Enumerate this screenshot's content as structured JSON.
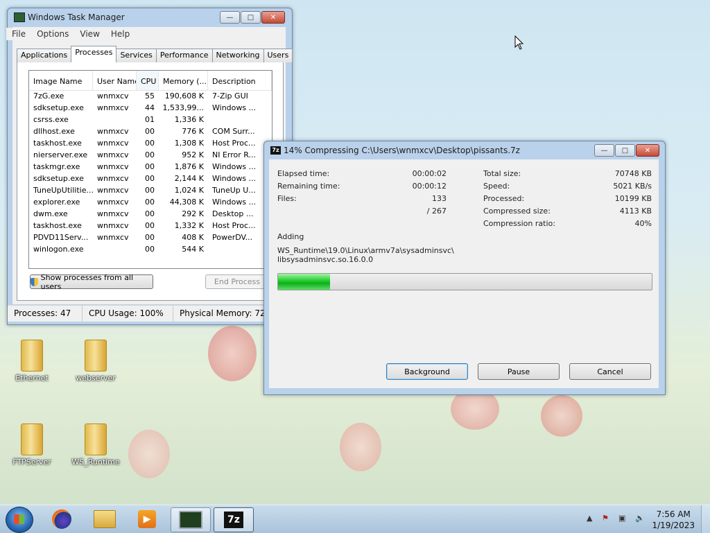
{
  "taskmgr": {
    "title": "Windows Task Manager",
    "menu": [
      "File",
      "Options",
      "View",
      "Help"
    ],
    "tabs": [
      "Applications",
      "Processes",
      "Services",
      "Performance",
      "Networking",
      "Users"
    ],
    "active_tab": "Processes",
    "columns": [
      "Image Name",
      "User Name",
      "CPU",
      "Memory (...",
      "Description"
    ],
    "rows": [
      [
        "7zG.exe",
        "wnmxcv",
        "55",
        "190,608 K",
        "7-Zip GUI"
      ],
      [
        "sdksetup.exe",
        "wnmxcv",
        "44",
        "1,533,99...",
        "Windows ..."
      ],
      [
        "csrss.exe",
        "",
        "01",
        "1,336 K",
        ""
      ],
      [
        "dllhost.exe",
        "wnmxcv",
        "00",
        "776 K",
        "COM Surr..."
      ],
      [
        "taskhost.exe",
        "wnmxcv",
        "00",
        "1,308 K",
        "Host Proc..."
      ],
      [
        "nierserver.exe",
        "wnmxcv",
        "00",
        "952 K",
        "NI Error R..."
      ],
      [
        "taskmgr.exe",
        "wnmxcv",
        "00",
        "1,876 K",
        "Windows ..."
      ],
      [
        "sdksetup.exe",
        "wnmxcv",
        "00",
        "2,144 K",
        "Windows ..."
      ],
      [
        "TuneUpUtilitie...",
        "wnmxcv",
        "00",
        "1,024 K",
        "TuneUp U..."
      ],
      [
        "explorer.exe",
        "wnmxcv",
        "00",
        "44,308 K",
        "Windows ..."
      ],
      [
        "dwm.exe",
        "wnmxcv",
        "00",
        "292 K",
        "Desktop ..."
      ],
      [
        "taskhost.exe",
        "wnmxcv",
        "00",
        "1,332 K",
        "Host Proc..."
      ],
      [
        "PDVD11Serv...",
        "wnmxcv",
        "00",
        "408 K",
        "PowerDV..."
      ],
      [
        "winlogon.exe",
        "",
        "00",
        "544 K",
        ""
      ]
    ],
    "show_all_label": "Show processes from all users",
    "end_process_label": "End Process",
    "status": {
      "processes": "Processes: 47",
      "cpu": "CPU Usage: 100%",
      "memory": "Physical Memory: 72%"
    }
  },
  "sevenzip": {
    "title": "14% Compressing C:\\Users\\wnmxcv\\Desktop\\pissants.7z",
    "elapsed_label": "Elapsed time:",
    "elapsed_value": "00:00:02",
    "remaining_label": "Remaining time:",
    "remaining_value": "00:00:12",
    "files_label": "Files:",
    "files_value": "133",
    "files_total": "/ 267",
    "total_size_label": "Total size:",
    "total_size_value": "70748 KB",
    "speed_label": "Speed:",
    "speed_value": "5021 KB/s",
    "processed_label": "Processed:",
    "processed_value": "10199 KB",
    "compressed_label": "Compressed size:",
    "compressed_value": "4113 KB",
    "ratio_label": "Compression ratio:",
    "ratio_value": "40%",
    "adding_label": "Adding",
    "current_path_line1": "WS_Runtime\\19.0\\Linux\\armv7a\\sysadminsvc\\",
    "current_path_line2": "libsysadminsvc.so.16.0.0",
    "progress_percent": 14,
    "background_label": "Background",
    "pause_label": "Pause",
    "cancel_label": "Cancel"
  },
  "desktop_icons": [
    "Ethernet",
    "webserver",
    "FTPServer",
    "WS_Runtime"
  ],
  "taskbar": {
    "time": "7:56 AM",
    "date": "1/19/2023",
    "pinned": [
      "firefox-icon",
      "explorer-folder-icon",
      "media-player-icon",
      "task-manager-icon",
      "7zip-icon"
    ]
  }
}
